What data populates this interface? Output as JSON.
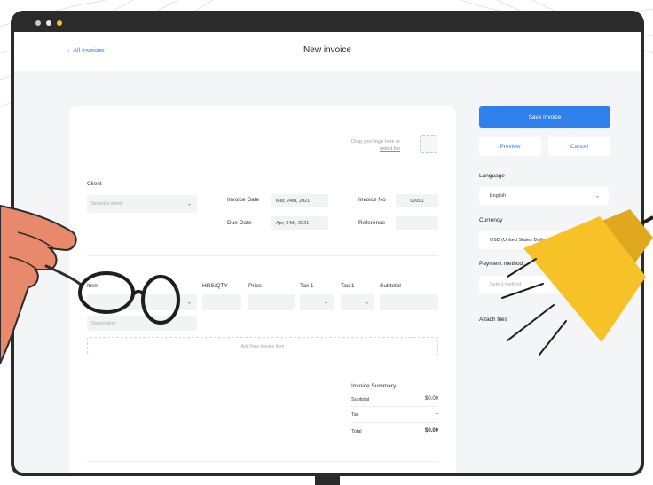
{
  "window": {
    "dots": [
      "#c9c9c9",
      "#e9e9e9",
      "#f2c230"
    ]
  },
  "header": {
    "back_label": "All Invoices",
    "title": "New invoice"
  },
  "form": {
    "logo_hint_line1": "Drag your logo here or",
    "logo_hint_line2": "select file",
    "client_label": "Client",
    "client_placeholder": "Select a client",
    "invoice_date_label": "Invoice Date",
    "invoice_date_value": "Mar, 24th, 2021",
    "due_date_label": "Due Date",
    "due_date_value": "Apr, 24th, 2021",
    "invoice_no_label": "Invoice No",
    "invoice_no_value": "00001",
    "reference_label": "Reference",
    "reference_value": ""
  },
  "items": {
    "columns": [
      "Item",
      "HRS/QTY",
      "Price",
      "Tax 1",
      "Tax 1",
      "Subtotal"
    ],
    "description_placeholder": "Description",
    "add_label": "Add New Invoice Item"
  },
  "summary": {
    "title": "Invoice Summary",
    "rows": [
      {
        "label": "Subtotal",
        "value": "$0.00"
      },
      {
        "label": "Tax",
        "value": "–"
      },
      {
        "label": "Total",
        "value": "$0.00"
      }
    ]
  },
  "sidebar": {
    "save_label": "Save invoice",
    "preview_label": "Preview",
    "cancel_label": "Cancel",
    "language_label": "Language",
    "language_value": "English",
    "currency_label": "Currency",
    "currency_value": "USD (United States Dollar)",
    "payment_label": "Payment method",
    "payment_placeholder": "Select method",
    "attach_label": "Attach files"
  },
  "colors": {
    "accent": "#2f80ed",
    "hand": "#e8896b",
    "lamp": "#f7c227"
  }
}
